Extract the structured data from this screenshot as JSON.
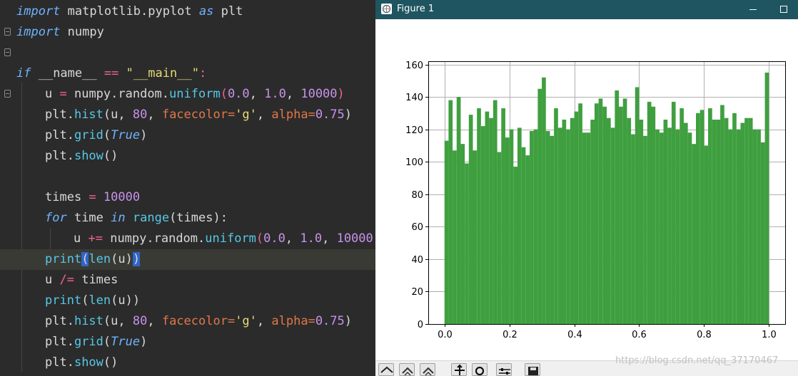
{
  "editor": {
    "lines": {
      "l1": {
        "k1": "import",
        "t1": " matplotlib.pyplot ",
        "k2": "as",
        "t2": " plt"
      },
      "l2": {
        "k1": "import",
        "t1": " numpy"
      },
      "l4": {
        "k1": "if",
        "t1": " __name__ ",
        "o1": "==",
        "t2": " ",
        "s1": "\"__main__\"",
        "t3": ":"
      },
      "l5": {
        "t1": "u ",
        "o1": "=",
        "t2": " numpy.random.",
        "f1": "uniform",
        "t3": "(",
        "n1": "0.0",
        "t4": ", ",
        "n2": "1.0",
        "t5": ", ",
        "n3": "10000",
        "t6": ")"
      },
      "l6": {
        "t1": "plt.",
        "f1": "hist",
        "t2": "(u, ",
        "n1": "80",
        "t3": ", ",
        "p1": "facecolor=",
        "s1": "'g'",
        "t4": ", ",
        "p2": "alpha=",
        "n2": "0.75",
        "t5": ")"
      },
      "l7": {
        "t1": "plt.",
        "f1": "grid",
        "t2": "(",
        "k1": "True",
        "t3": ")"
      },
      "l8": {
        "t1": "plt.",
        "f1": "show",
        "t2": "()"
      },
      "l10": {
        "t1": "times ",
        "o1": "=",
        "t2": " ",
        "n1": "10000"
      },
      "l11": {
        "k1": "for",
        "t1": " time ",
        "k2": "in",
        "t2": " ",
        "f1": "range",
        "t3": "(times):"
      },
      "l12": {
        "t1": "u ",
        "o1": "+=",
        "t2": " numpy.random.",
        "f1": "uniform",
        "t3": "(",
        "n1": "0.0",
        "t4": ", ",
        "n2": "1.0",
        "t5": ", ",
        "n3": "10000",
        "t6": ")"
      },
      "l13": {
        "f1": "print",
        "t1": "(",
        "f2": "len",
        "t2": "(u)",
        "t3": ")"
      },
      "l14": {
        "t1": "u ",
        "o1": "/=",
        "t2": " times"
      },
      "l15": {
        "f1": "print",
        "t1": "(",
        "f2": "len",
        "t2": "(u))"
      },
      "l16": {
        "t1": "plt.",
        "f1": "hist",
        "t2": "(u, ",
        "n1": "80",
        "t3": ", ",
        "p1": "facecolor=",
        "s1": "'g'",
        "t4": ", ",
        "p2": "alpha=",
        "n2": "0.75",
        "t5": ")"
      },
      "l17": {
        "t1": "plt.",
        "f1": "grid",
        "t2": "(",
        "k1": "True",
        "t3": ")"
      },
      "l18": {
        "t1": "plt.",
        "f1": "show",
        "t2": "()"
      }
    }
  },
  "figure_window": {
    "title": "Figure 1",
    "minimize_icon": "minimize-icon",
    "maximize_icon": "maximize-icon",
    "toolbar_icons": [
      "home-icon",
      "back-icon",
      "forward-icon",
      "pan-icon",
      "zoom-icon",
      "configure-subplots-icon",
      "save-icon"
    ]
  },
  "watermark": "https://blog.csdn.net/qq_37170467",
  "colors": {
    "bar": "#3f9f3f",
    "editor_bg": "#2b2b2b",
    "titlebar": "#1e5561",
    "grid": "#b0b0b0"
  },
  "chart_data": {
    "type": "bar",
    "title": "",
    "xlabel": "",
    "ylabel": "",
    "bins": 80,
    "bin_range": [
      0.0,
      1.0
    ],
    "values": [
      113,
      138,
      107,
      140,
      111,
      99,
      129,
      107,
      133,
      122,
      131,
      127,
      138,
      106,
      133,
      115,
      120,
      97,
      121,
      109,
      104,
      119,
      120,
      145,
      152,
      119,
      116,
      133,
      121,
      126,
      120,
      127,
      131,
      136,
      118,
      118,
      126,
      136,
      139,
      134,
      127,
      121,
      144,
      134,
      139,
      127,
      117,
      146,
      126,
      116,
      137,
      134,
      120,
      118,
      126,
      121,
      137,
      120,
      133,
      124,
      118,
      111,
      130,
      132,
      110,
      133,
      126,
      126,
      135,
      127,
      120,
      130,
      120,
      124,
      127,
      127,
      120,
      120,
      112,
      155
    ],
    "xlim": [
      -0.05,
      1.05
    ],
    "ylim": [
      0,
      162
    ],
    "xticks": [
      "0.0",
      "0.2",
      "0.4",
      "0.6",
      "0.8",
      "1.0"
    ],
    "xtick_values": [
      0.0,
      0.2,
      0.4,
      0.6,
      0.8,
      1.0
    ],
    "yticks": [
      "0",
      "20",
      "40",
      "60",
      "80",
      "100",
      "120",
      "140",
      "160"
    ],
    "ytick_values": [
      0,
      20,
      40,
      60,
      80,
      100,
      120,
      140,
      160
    ],
    "grid": true,
    "legend": "none"
  }
}
